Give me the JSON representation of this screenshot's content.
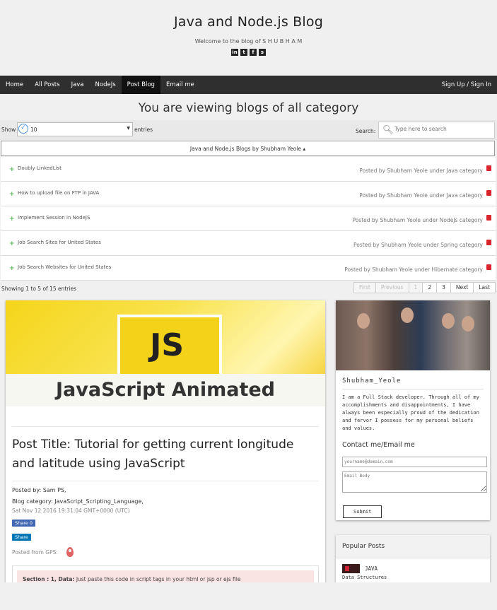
{
  "site": {
    "title": "Java and Node.js Blog",
    "subtitle": "Welcome to the blog of S H U B H A M",
    "social": [
      {
        "icon": "linkedin-icon",
        "glyph": "in"
      },
      {
        "icon": "twitter-icon",
        "glyph": "t"
      },
      {
        "icon": "facebook-icon",
        "glyph": "f"
      },
      {
        "icon": "stackoverflow-icon",
        "glyph": "s"
      }
    ]
  },
  "nav": {
    "items": [
      "Home",
      "All Posts",
      "Java",
      "NodeJs",
      "Post Blog",
      "Email me"
    ],
    "active": "Post Blog",
    "signin": "Sign Up / Sign In"
  },
  "heading": "You are viewing blogs of all category",
  "table": {
    "show_label": "Show",
    "length_value": "10",
    "entries_label": "entries",
    "search_label": "Search:",
    "search_placeholder": "Type here to search",
    "column_header": "Java and Node.js Blogs by Shubham Yeole ▴",
    "rows": [
      {
        "title": "Doubly LinkedList",
        "meta": "Posted by Shubham Yeole under Java category"
      },
      {
        "title": "How to upload file on FTP in JAVA",
        "meta": "Posted by Shubham Yeole under Java category"
      },
      {
        "title": "Implement Session in NodeJS",
        "meta": "Posted by Shubham Yeole under NodeJs category"
      },
      {
        "title": "Job Search Sites for United States",
        "meta": "Posted by Shubham Yeole under Spring category"
      },
      {
        "title": "Job Search Websites for United States",
        "meta": "Posted by Shubham Yeole under Hibernate category"
      }
    ],
    "info": "Showing 1 to 5 of 15 entries",
    "pager": {
      "first": "First",
      "previous": "Previous",
      "pages": [
        "1",
        "2",
        "3"
      ],
      "next": "Next",
      "last": "Last"
    }
  },
  "post": {
    "banner_logo": "JS",
    "banner_text": "JavaScript Animated",
    "title": "Post Title: Tutorial for getting current longitude and latitude using JavaScript",
    "posted_by": "Posted by: Sam PS,",
    "category": "Blog category: JavaScript_Scripting_Language,",
    "date": "Sat Nov 12 2016 19:31:04 GMT+0000 (UTC)",
    "fb_share": "Share 0",
    "in_share": "Share",
    "gps_label": "Posted from GPS:",
    "section_label": "Section : 1, Data:",
    "section_text": "Just paste this code in script tags in your html or jsp or ejs file"
  },
  "profile": {
    "name": "Shubham_Yeole",
    "about": "I am a Full Stack developer. Through all of my accomplishments and disappointments, I have always been especially proud of the dedication and fervor I possess for my personal beliefs and values.",
    "contact_heading": "Contact me/Email me",
    "email_placeholder": "yourname@domain.com",
    "body_placeholder": "Email Body",
    "submit": "Submit"
  },
  "popular": {
    "heading": "Popular Posts",
    "items": [
      {
        "title": "JAVA",
        "subtitle": "Data Structures"
      }
    ]
  },
  "colors": {
    "nav_bg": "#2f2f2f",
    "delete_red": "#d9232d",
    "plus_green": "#5cb85c",
    "accent_blue": "#4a90d9"
  }
}
